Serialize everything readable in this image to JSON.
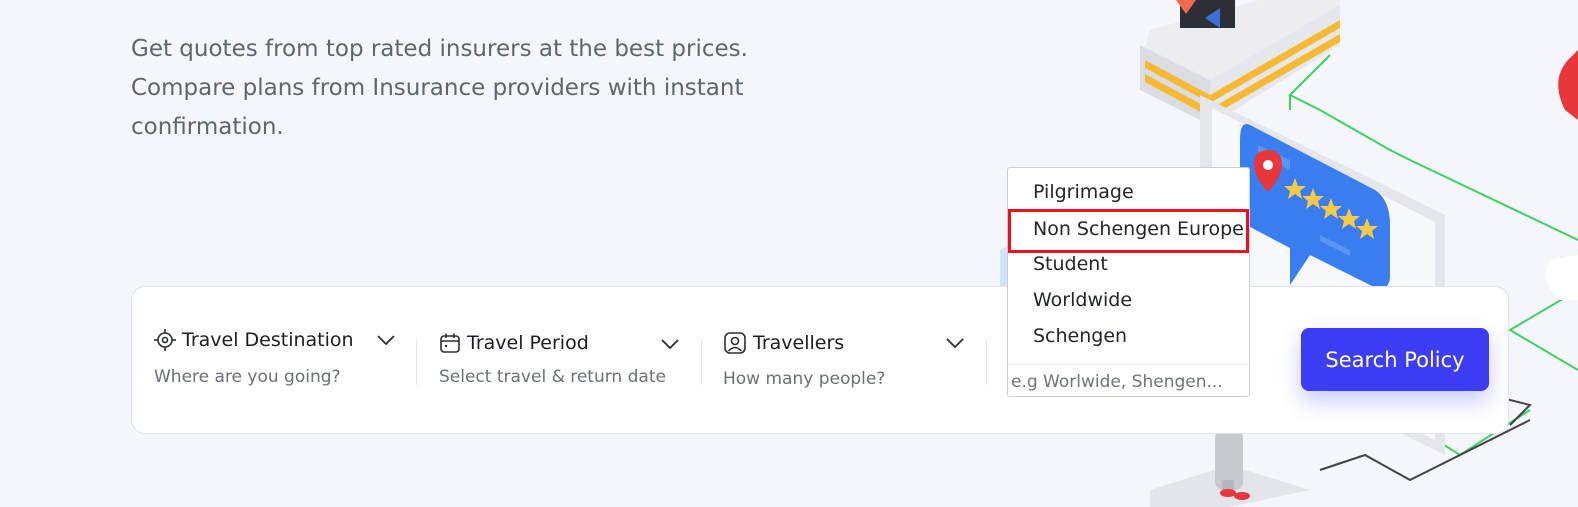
{
  "hero": {
    "subtitle_line1": "Get quotes from top rated insurers at the best prices.",
    "subtitle_line2": "Compare plans from Insurance providers with instant",
    "subtitle_line3": "confirmation."
  },
  "search": {
    "fields": [
      {
        "label": "Travel Destination",
        "hint": "Where are you going?",
        "icon": "location-target-icon"
      },
      {
        "label": "Travel Period",
        "hint": "Select travel & return date",
        "icon": "calendar-icon"
      },
      {
        "label": "Travellers",
        "hint": "How many people?",
        "icon": "user-icon"
      }
    ],
    "plan_type_placeholder": "e.g Worlwide, Shengen...",
    "button_label": "Search Policy"
  },
  "dropdown": {
    "options": [
      "Pilgrimage",
      "Non Schengen Europe",
      "Student",
      "Worldwide",
      "Schengen"
    ],
    "highlighted": "Non Schengen Europe"
  },
  "colors": {
    "accent": "#3d3df5",
    "highlight_border": "#e8131c",
    "background": "#f4f6fb"
  }
}
